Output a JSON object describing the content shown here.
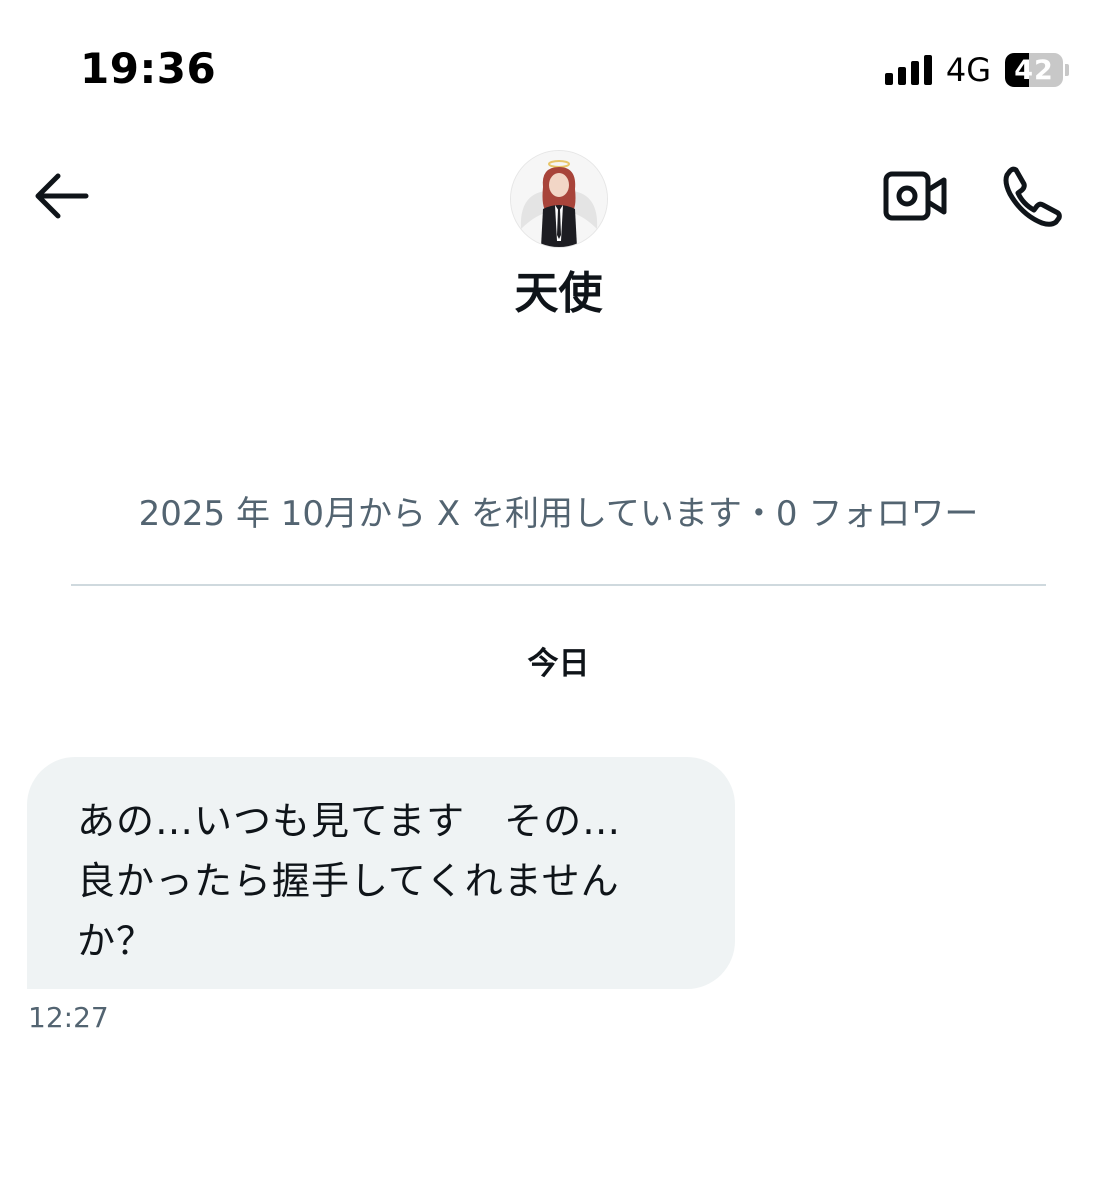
{
  "status_bar": {
    "time": "19:36",
    "network": "4G",
    "battery": "42",
    "battery_level_percent": 42,
    "signal_bars": 4
  },
  "header": {
    "back_icon": "arrow-left-icon",
    "video_call_icon": "video-camera-icon",
    "voice_call_icon": "phone-icon",
    "avatar_icon": "angel-avatar",
    "name": "天使"
  },
  "profile_meta": "2025 年 10月から X を利用しています・0 フォロワー",
  "conversation": {
    "day_label": "今日",
    "messages": [
      {
        "lines": [
          "あの…いつも見てます　その…",
          "良かったら握手してくれません",
          "か？"
        ],
        "time": "12:27"
      }
    ]
  },
  "colors": {
    "text_primary": "#0f1419",
    "text_secondary": "#536471",
    "bubble_bg": "#eff3f4",
    "divider": "#cfd9de"
  }
}
